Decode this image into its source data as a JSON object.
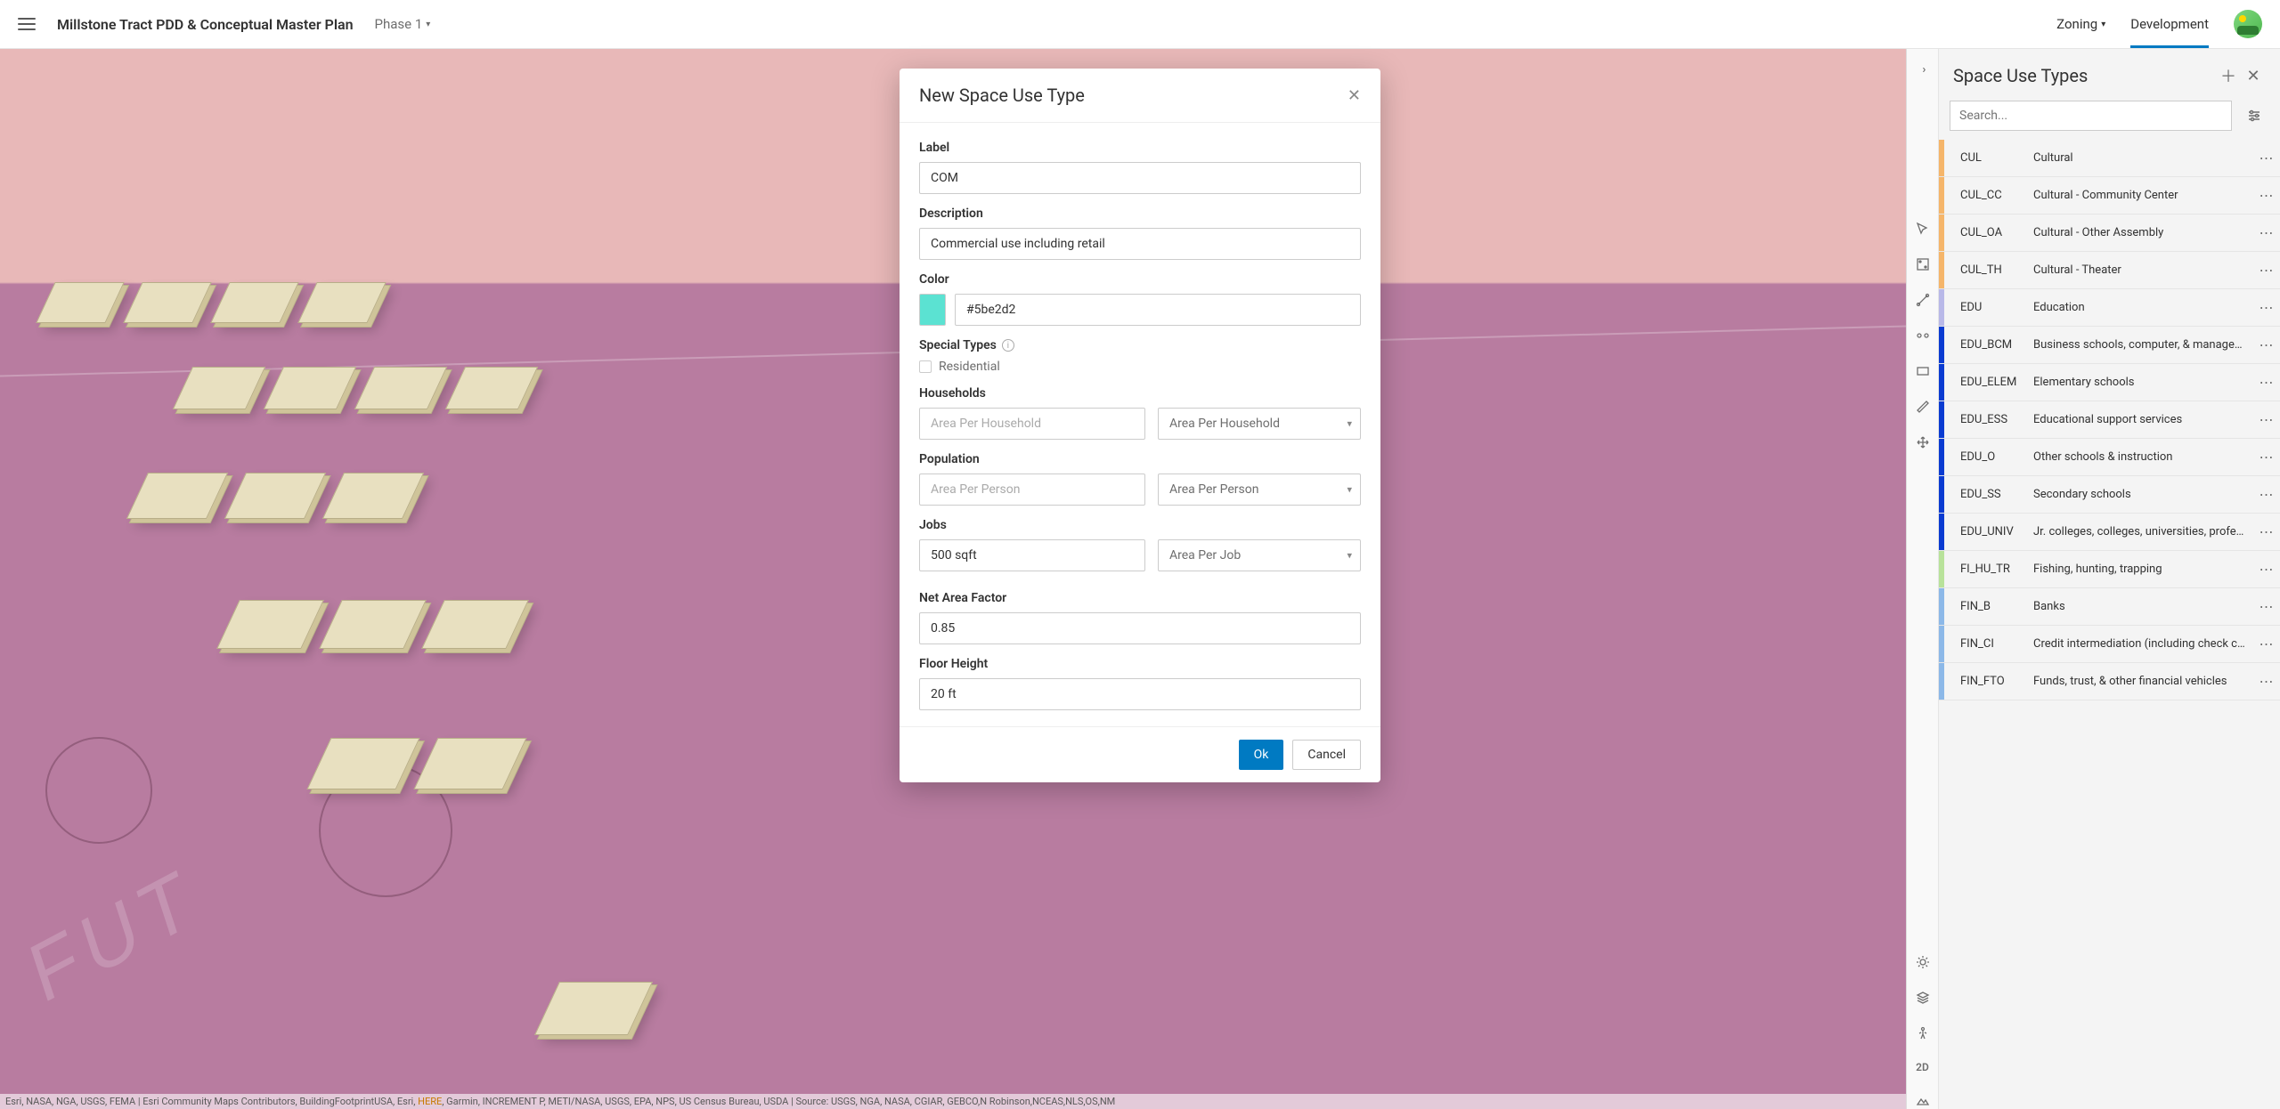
{
  "header": {
    "project_title": "Millstone Tract PDD & Conceptual Master Plan",
    "phase_label": "Phase 1",
    "nav": {
      "zoning": "Zoning",
      "development": "Development"
    }
  },
  "canvas": {
    "ground_text": "FUT",
    "attribution_prefix": "Esri, NASA, NGA, USGS, FEMA | Esri Community Maps Contributors, BuildingFootprintUSA, Esri, ",
    "attribution_here": "HERE",
    "attribution_suffix": ", Garmin, INCREMENT P, METI/NASA, USGS, EPA, NPS, US Census Bureau, USDA | Source: USGS, NGA, NASA, CGIAR, GEBCO,N Robinson,NCEAS,NLS,OS,NM"
  },
  "modal": {
    "title": "New Space Use Type",
    "labels": {
      "label": "Label",
      "description": "Description",
      "color": "Color",
      "special_types": "Special Types",
      "residential": "Residential",
      "households": "Households",
      "population": "Population",
      "jobs": "Jobs",
      "net_area_factor": "Net Area Factor",
      "floor_height": "Floor Height"
    },
    "values": {
      "label": "COM",
      "description": "Commercial use including retail",
      "color": "#5be2d2",
      "households_input": "",
      "households_unit": "Area Per Household",
      "households_placeholder": "Area Per Household",
      "population_input": "",
      "population_unit": "Area Per Person",
      "population_placeholder": "Area Per Person",
      "jobs_input": "500 sqft",
      "jobs_unit": "Area Per Job",
      "net_area_factor": "0.85",
      "floor_height": "20 ft"
    },
    "buttons": {
      "ok": "Ok",
      "cancel": "Cancel"
    }
  },
  "panel": {
    "title": "Space Use Types",
    "search_placeholder": "Search...",
    "tool_rail": {
      "mode_2d": "2D"
    },
    "types": [
      {
        "code": "CUL",
        "name": "Cultural",
        "color": "#f5b56a"
      },
      {
        "code": "CUL_CC",
        "name": "Cultural - Community Center",
        "color": "#f5b56a"
      },
      {
        "code": "CUL_OA",
        "name": "Cultural - Other Assembly",
        "color": "#f5b56a"
      },
      {
        "code": "CUL_TH",
        "name": "Cultural - Theater",
        "color": "#f5b56a"
      },
      {
        "code": "EDU",
        "name": "Education",
        "color": "#b8b8e8"
      },
      {
        "code": "EDU_BCM",
        "name": "Business schools, computer, & management…",
        "color": "#0a3bd1"
      },
      {
        "code": "EDU_ELEM",
        "name": "Elementary schools",
        "color": "#0a3bd1"
      },
      {
        "code": "EDU_ESS",
        "name": "Educational support services",
        "color": "#0a3bd1"
      },
      {
        "code": "EDU_O",
        "name": "Other schools & instruction",
        "color": "#0a3bd1"
      },
      {
        "code": "EDU_SS",
        "name": "Secondary schools",
        "color": "#0a3bd1"
      },
      {
        "code": "EDU_UNIV",
        "name": "Jr. colleges, colleges, universities, professio…",
        "color": "#0a3bd1"
      },
      {
        "code": "FI_HU_TR",
        "name": "Fishing, hunting, trapping",
        "color": "#b8e29a"
      },
      {
        "code": "FIN_B",
        "name": "Banks",
        "color": "#8cb8e8"
      },
      {
        "code": "FIN_CI",
        "name": "Credit intermediation (including check cashi…",
        "color": "#8cb8e8"
      },
      {
        "code": "FIN_FTO",
        "name": "Funds, trust, & other financial vehicles",
        "color": "#8cb8e8"
      }
    ]
  }
}
